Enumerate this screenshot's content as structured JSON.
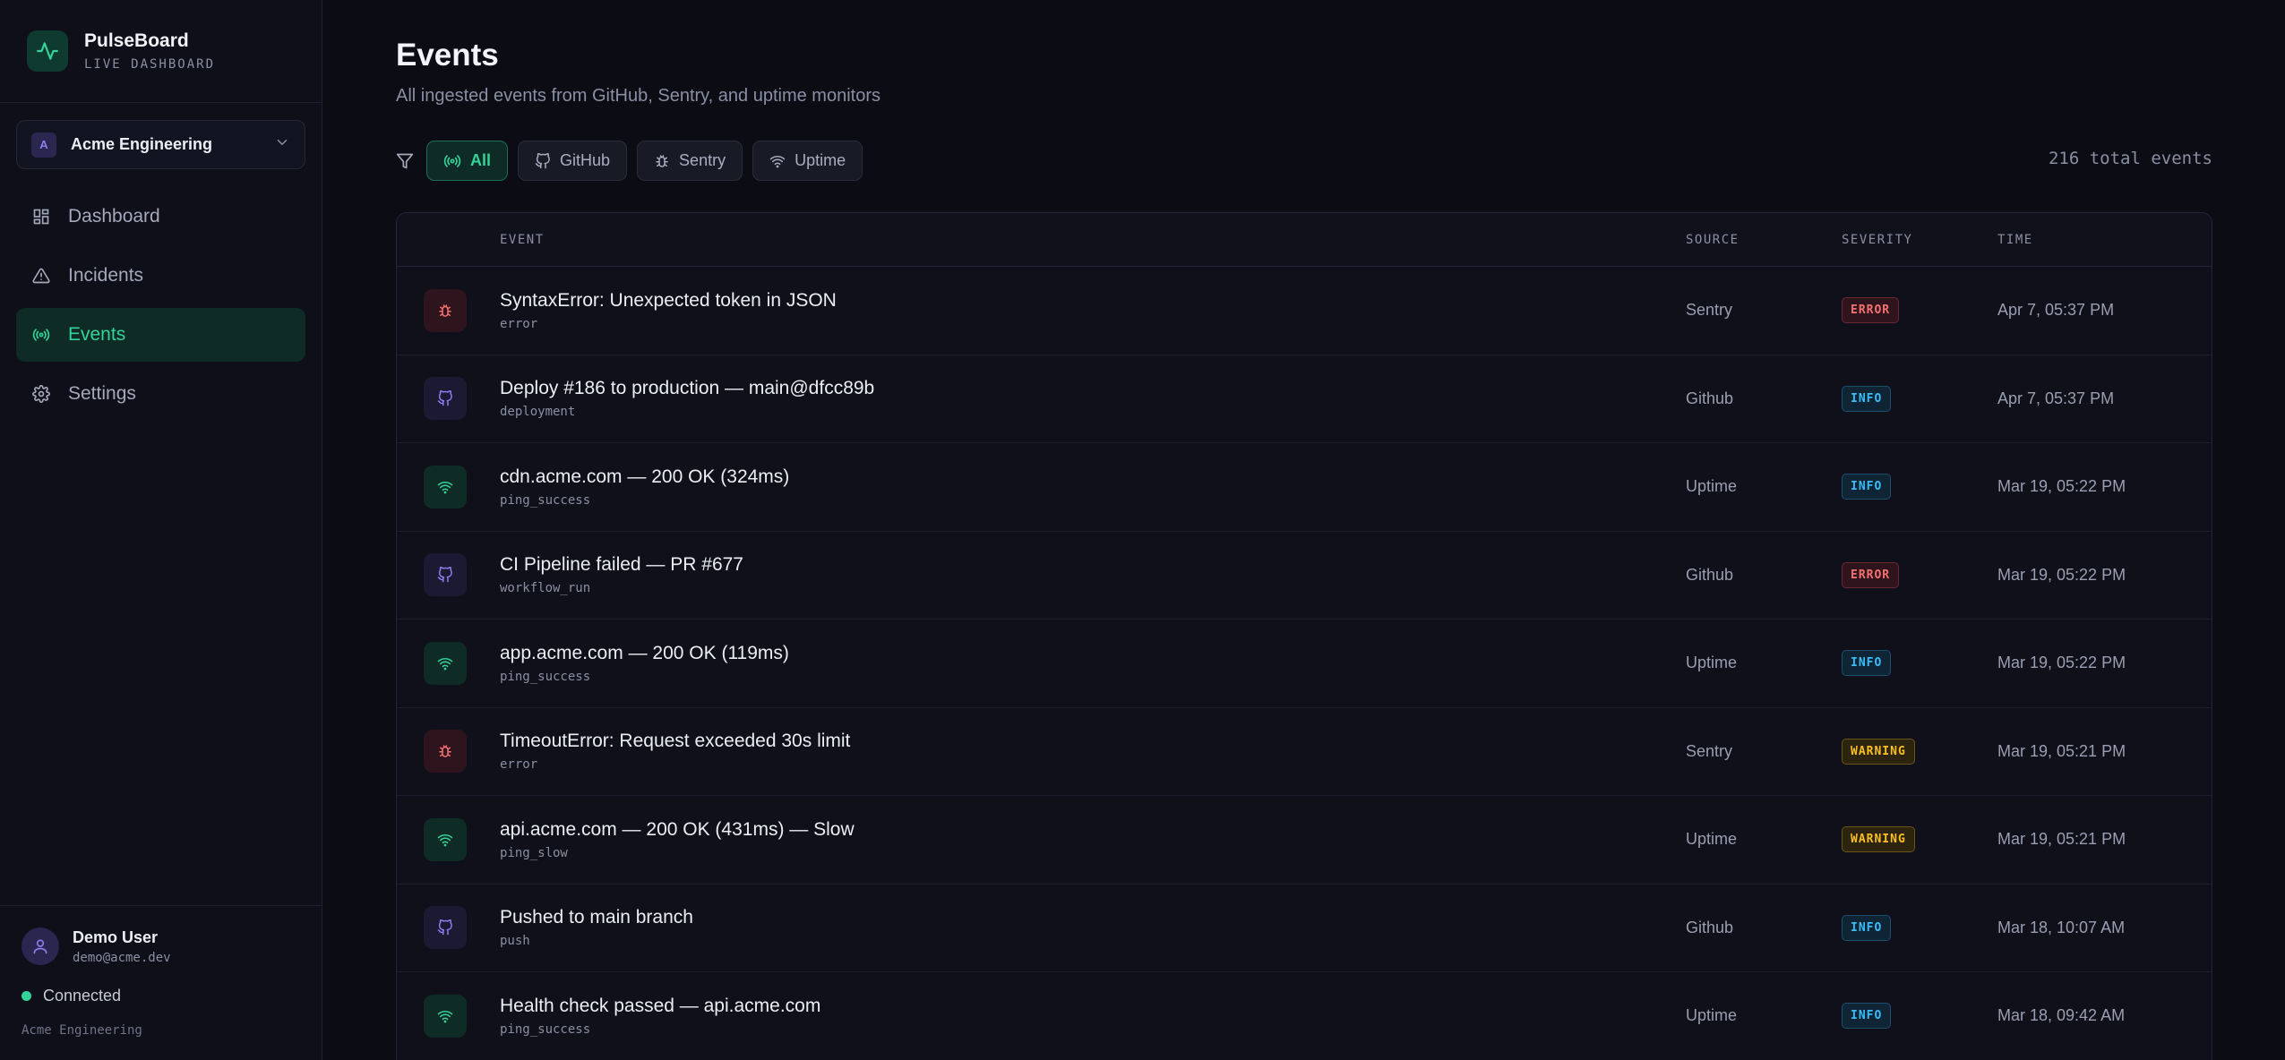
{
  "app": {
    "name": "PulseBoard",
    "subtitle": "LIVE DASHBOARD"
  },
  "org": {
    "initial": "A",
    "name": "Acme Engineering"
  },
  "nav": [
    {
      "label": "Dashboard",
      "icon": "grid-icon",
      "active": false
    },
    {
      "label": "Incidents",
      "icon": "alert-triangle-icon",
      "active": false
    },
    {
      "label": "Events",
      "icon": "radio-icon",
      "active": true
    },
    {
      "label": "Settings",
      "icon": "gear-icon",
      "active": false
    }
  ],
  "user": {
    "name": "Demo User",
    "email": "demo@acme.dev",
    "status": "Connected",
    "workspace": "Acme Engineering"
  },
  "page": {
    "title": "Events",
    "subtitle": "All ingested events from GitHub, Sentry, and uptime monitors",
    "total": "216 total events"
  },
  "filters": [
    {
      "label": "All",
      "icon": "radio-icon",
      "active": true
    },
    {
      "label": "GitHub",
      "icon": "github-icon",
      "active": false
    },
    {
      "label": "Sentry",
      "icon": "bug-icon",
      "active": false
    },
    {
      "label": "Uptime",
      "icon": "wifi-icon",
      "active": false
    }
  ],
  "table": {
    "headers": {
      "event": "EVENT",
      "source": "SOURCE",
      "severity": "SEVERITY",
      "time": "TIME"
    },
    "rows": [
      {
        "kind": "sentry",
        "title": "SyntaxError: Unexpected token in JSON",
        "type": "error",
        "source": "Sentry",
        "severity": "ERROR",
        "time": "Apr 7, 05:37 PM"
      },
      {
        "kind": "github",
        "title": "Deploy #186 to production — main@dfcc89b",
        "type": "deployment",
        "source": "Github",
        "severity": "INFO",
        "time": "Apr 7, 05:37 PM"
      },
      {
        "kind": "uptime",
        "title": "cdn.acme.com — 200 OK (324ms)",
        "type": "ping_success",
        "source": "Uptime",
        "severity": "INFO",
        "time": "Mar 19, 05:22 PM"
      },
      {
        "kind": "github",
        "title": "CI Pipeline failed — PR #677",
        "type": "workflow_run",
        "source": "Github",
        "severity": "ERROR",
        "time": "Mar 19, 05:22 PM"
      },
      {
        "kind": "uptime",
        "title": "app.acme.com — 200 OK (119ms)",
        "type": "ping_success",
        "source": "Uptime",
        "severity": "INFO",
        "time": "Mar 19, 05:22 PM"
      },
      {
        "kind": "sentry",
        "title": "TimeoutError: Request exceeded 30s limit",
        "type": "error",
        "source": "Sentry",
        "severity": "WARNING",
        "time": "Mar 19, 05:21 PM"
      },
      {
        "kind": "uptime",
        "title": "api.acme.com — 200 OK (431ms) — Slow",
        "type": "ping_slow",
        "source": "Uptime",
        "severity": "WARNING",
        "time": "Mar 19, 05:21 PM"
      },
      {
        "kind": "github",
        "title": "Pushed to main branch",
        "type": "push",
        "source": "Github",
        "severity": "INFO",
        "time": "Mar 18, 10:07 AM"
      },
      {
        "kind": "uptime",
        "title": "Health check passed — api.acme.com",
        "type": "ping_success",
        "source": "Uptime",
        "severity": "INFO",
        "time": "Mar 18, 09:42 AM"
      }
    ]
  }
}
